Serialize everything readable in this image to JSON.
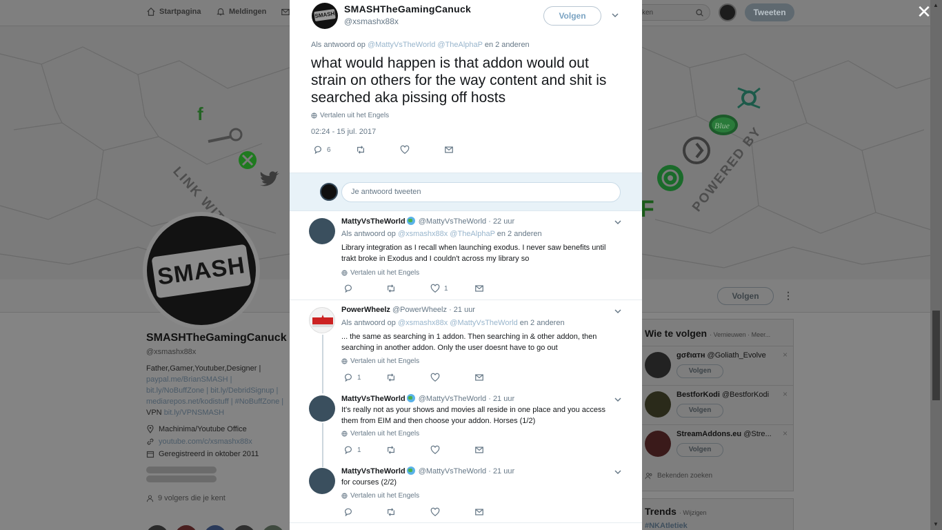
{
  "background": {
    "nav": [
      {
        "label": "Startpagina",
        "icon": "home-icon"
      },
      {
        "label": "Meldingen",
        "icon": "bell-icon"
      }
    ],
    "search_placeholder": "ken",
    "tweet_button": "Tweeten",
    "banner_texts": {
      "link_with_me": "LINK WITH ME",
      "powered_by": "POWERED BY",
      "blue": "Blue"
    },
    "profile": {
      "name": "SMASHTheGamingCanuck",
      "handle": "@xsmashx88x",
      "bio_text": "Father,Gamer,Youtuber,Designer |",
      "bio_links": [
        "paypal.me/BrianSMASH |",
        "bit.ly/NoBuffZone | bit.ly/DebridSignup |",
        "mediarepos.net/kodistuff | #NoBuffZone |"
      ],
      "bio_vpn_prefix": "VPN",
      "bio_vpn_link": "bit.ly/VPNSMASH",
      "location": "Machinima/Youtube Office",
      "website": "youtube.com/c/xsmashx88x",
      "joined": "Geregistreerd in oktober 2011",
      "followers_you_know": "9 volgers die je kent",
      "follow_button": "Volgen",
      "avatar_text": "SMASH"
    },
    "who_to_follow": {
      "title": "Wie te volgen",
      "links": "· Vernieuwen · Meer...",
      "items": [
        {
          "name": "gσℓιαтн",
          "handle": "@Goliath_Evolve",
          "button": "Volgen"
        },
        {
          "name": "BestforKodi",
          "handle": "@BestforKodi",
          "button": "Volgen"
        },
        {
          "name": "StreamAddons.eu",
          "handle": "@Stre...",
          "button": "Volgen"
        }
      ],
      "find_friends": "Bekenden zoeken"
    },
    "trends": {
      "title": "Trends",
      "link": "· Wijzigen",
      "first": "#NKAtletiek"
    }
  },
  "modal": {
    "tweet": {
      "name": "SMASHTheGamingCanuck",
      "handle": "@xsmashx88x",
      "follow_label": "Volgen",
      "reply_prefix": "Als antwoord op",
      "reply_mentions": "@MattyVsTheWorld @TheAlphaP",
      "reply_suffix": "en 2 anderen",
      "text": "what would happen is that addon would out strain on others for the way content and shit is searched aka pissing off hosts",
      "translate": "Vertalen uit het Engels",
      "timestamp": "02:24 - 15 jul. 2017",
      "reply_count": "6",
      "avatar_text": "SMASH"
    },
    "reply_box": {
      "placeholder": "Je antwoord tweeten"
    },
    "replies": [
      {
        "name": "MattyVsTheWorld",
        "handle": "@MattyVsTheWorld",
        "time": "· 22 uur",
        "reply_prefix": "Als antwoord op",
        "reply_mentions": "@xsmashx88x @TheAlphaP",
        "reply_suffix": "en 2 anderen",
        "text": "Library integration as I recall when launching exodus. I never saw benefits until trakt broke in Exodus and I couldn't across my library so",
        "translate": "Vertalen uit het Engels",
        "reply_count": "",
        "like_count": "1"
      },
      {
        "name": "PowerWheelz",
        "handle": "@PowerWheelz",
        "time": "· 21 uur",
        "reply_prefix": "Als antwoord op",
        "reply_mentions": "@xsmashx88x @MattyVsTheWorld",
        "reply_suffix": "en 2 anderen",
        "text": "... the same as searching in 1 addon. Then searching in & other addon, then searching in another addon. Only the user doesnt have to go out",
        "translate": "Vertalen uit het Engels",
        "reply_count": "1",
        "like_count": ""
      },
      {
        "name": "MattyVsTheWorld",
        "handle": "@MattyVsTheWorld",
        "time": "· 21 uur",
        "text": "It's really not as your shows and movies all reside in one place and you access them from EIM and then choose your addon. Horses (1/2)",
        "translate": "Vertalen uit het Engels",
        "reply_count": "1",
        "like_count": ""
      },
      {
        "name": "MattyVsTheWorld",
        "handle": "@MattyVsTheWorld",
        "time": "· 21 uur",
        "text": "for courses (2/2)",
        "translate": "Vertalen uit het Engels",
        "reply_count": "",
        "like_count": ""
      }
    ]
  },
  "colors": {
    "overlay": "#848484",
    "modal_bg": "#ffffff",
    "mention": "#98b5cc",
    "muted": "#657786",
    "reply_box_bg": "#e8f2f8"
  }
}
